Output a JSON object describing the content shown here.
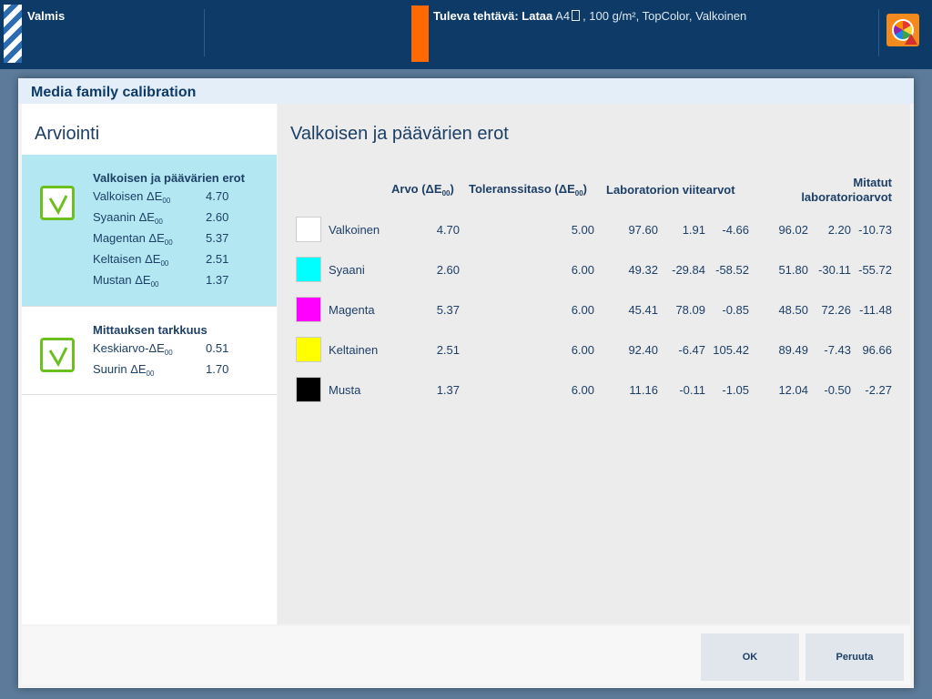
{
  "topbar": {
    "status": "Valmis",
    "next_job_label": "Tuleva tehtävä: Lataa",
    "next_job_size": "A4",
    "next_job_details": ", 100 g/m², TopColor, Valkoinen"
  },
  "dialog": {
    "title": "Media family calibration",
    "left_heading": "Arviointi",
    "cards": [
      {
        "title": "Valkoisen ja päävärien erot",
        "rows": [
          {
            "label": "Valkoisen ΔE",
            "sub": "00",
            "value": "4.70"
          },
          {
            "label": "Syaanin ΔE",
            "sub": "00",
            "value": "2.60"
          },
          {
            "label": "Magentan ΔE",
            "sub": "00",
            "value": "5.37"
          },
          {
            "label": "Keltaisen ΔE",
            "sub": "00",
            "value": "2.51"
          },
          {
            "label": "Mustan ΔE",
            "sub": "00",
            "value": "1.37"
          }
        ]
      },
      {
        "title": "Mittauksen tarkkuus",
        "rows": [
          {
            "label": "Keskiarvo-ΔE",
            "sub": "00",
            "value": "0.51"
          },
          {
            "label": "Suurin ΔE",
            "sub": "00",
            "value": "1.70"
          }
        ]
      }
    ],
    "right_heading": "Valkoisen ja päävärien erot",
    "table": {
      "headers": {
        "value": "Arvo (ΔE",
        "value_sub": "00",
        "value_close": ")",
        "tolerance": "Toleranssitaso (ΔE",
        "tolerance_sub": "00",
        "tolerance_close": ")",
        "lab_ref": "Laboratorion viitearvot",
        "measured_1": "Mitatut",
        "measured_2": "laboratorioarvot"
      },
      "rows": [
        {
          "name": "Valkoinen",
          "color": "#ffffff",
          "value": "4.70",
          "tolerance": "5.00",
          "ref": [
            "97.60",
            "1.91",
            "-4.66"
          ],
          "measured": [
            "96.02",
            "2.20",
            "-10.73"
          ]
        },
        {
          "name": "Syaani",
          "color": "#00ffff",
          "value": "2.60",
          "tolerance": "6.00",
          "ref": [
            "49.32",
            "-29.84",
            "-58.52"
          ],
          "measured": [
            "51.80",
            "-30.11",
            "-55.72"
          ]
        },
        {
          "name": "Magenta",
          "color": "#ff00ff",
          "value": "5.37",
          "tolerance": "6.00",
          "ref": [
            "45.41",
            "78.09",
            "-0.85"
          ],
          "measured": [
            "48.50",
            "72.26",
            "-11.48"
          ]
        },
        {
          "name": "Keltainen",
          "color": "#ffff00",
          "value": "2.51",
          "tolerance": "6.00",
          "ref": [
            "92.40",
            "-6.47",
            "105.42"
          ],
          "measured": [
            "89.49",
            "-7.43",
            "96.66"
          ]
        },
        {
          "name": "Musta",
          "color": "#000000",
          "value": "1.37",
          "tolerance": "6.00",
          "ref": [
            "11.16",
            "-0.11",
            "-1.05"
          ],
          "measured": [
            "12.04",
            "-0.50",
            "-2.27"
          ]
        }
      ]
    },
    "buttons": {
      "ok": "OK",
      "cancel": "Peruuta"
    }
  }
}
